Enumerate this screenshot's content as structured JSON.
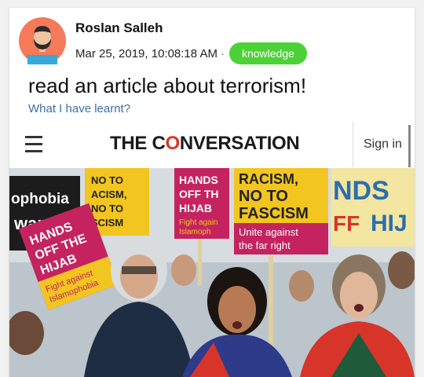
{
  "post": {
    "author": "Roslan Salleh",
    "timestamp": "Mar 25, 2019, 10:08:18 AM",
    "separator": "·",
    "tag": "knowledge",
    "text": "read an article about terrorism!",
    "subtitle": "What I have learnt?"
  },
  "embed": {
    "logo_part1": "THE C",
    "logo_o": "O",
    "logo_part2": "NVERSATION",
    "sign_in": "Sign in",
    "photo_signs": {
      "left_partial": "ophobia war.",
      "sign_1_text": "HANDS OFF THE HIJAB",
      "sign_1_subtext": "Fight against Islamophobia",
      "sign_2_partial": "NO TO RACISM, NO TO FASCISM",
      "sign_3_top": "HANDS OFF THE HIJAB",
      "sign_3_sub": "Fight against Islamophobia",
      "sign_4_title": "RACISM, NO TO FASCISM",
      "sign_4_sub": "Unite against the far right",
      "sign_5_partial": "NDS HIJ"
    }
  },
  "colors": {
    "tag_bg": "#4cd137",
    "subtitle": "#3d6fa8",
    "logo_accent": "#d8352a",
    "sign_yellow": "#f2c520",
    "sign_magenta": "#c4235f"
  }
}
